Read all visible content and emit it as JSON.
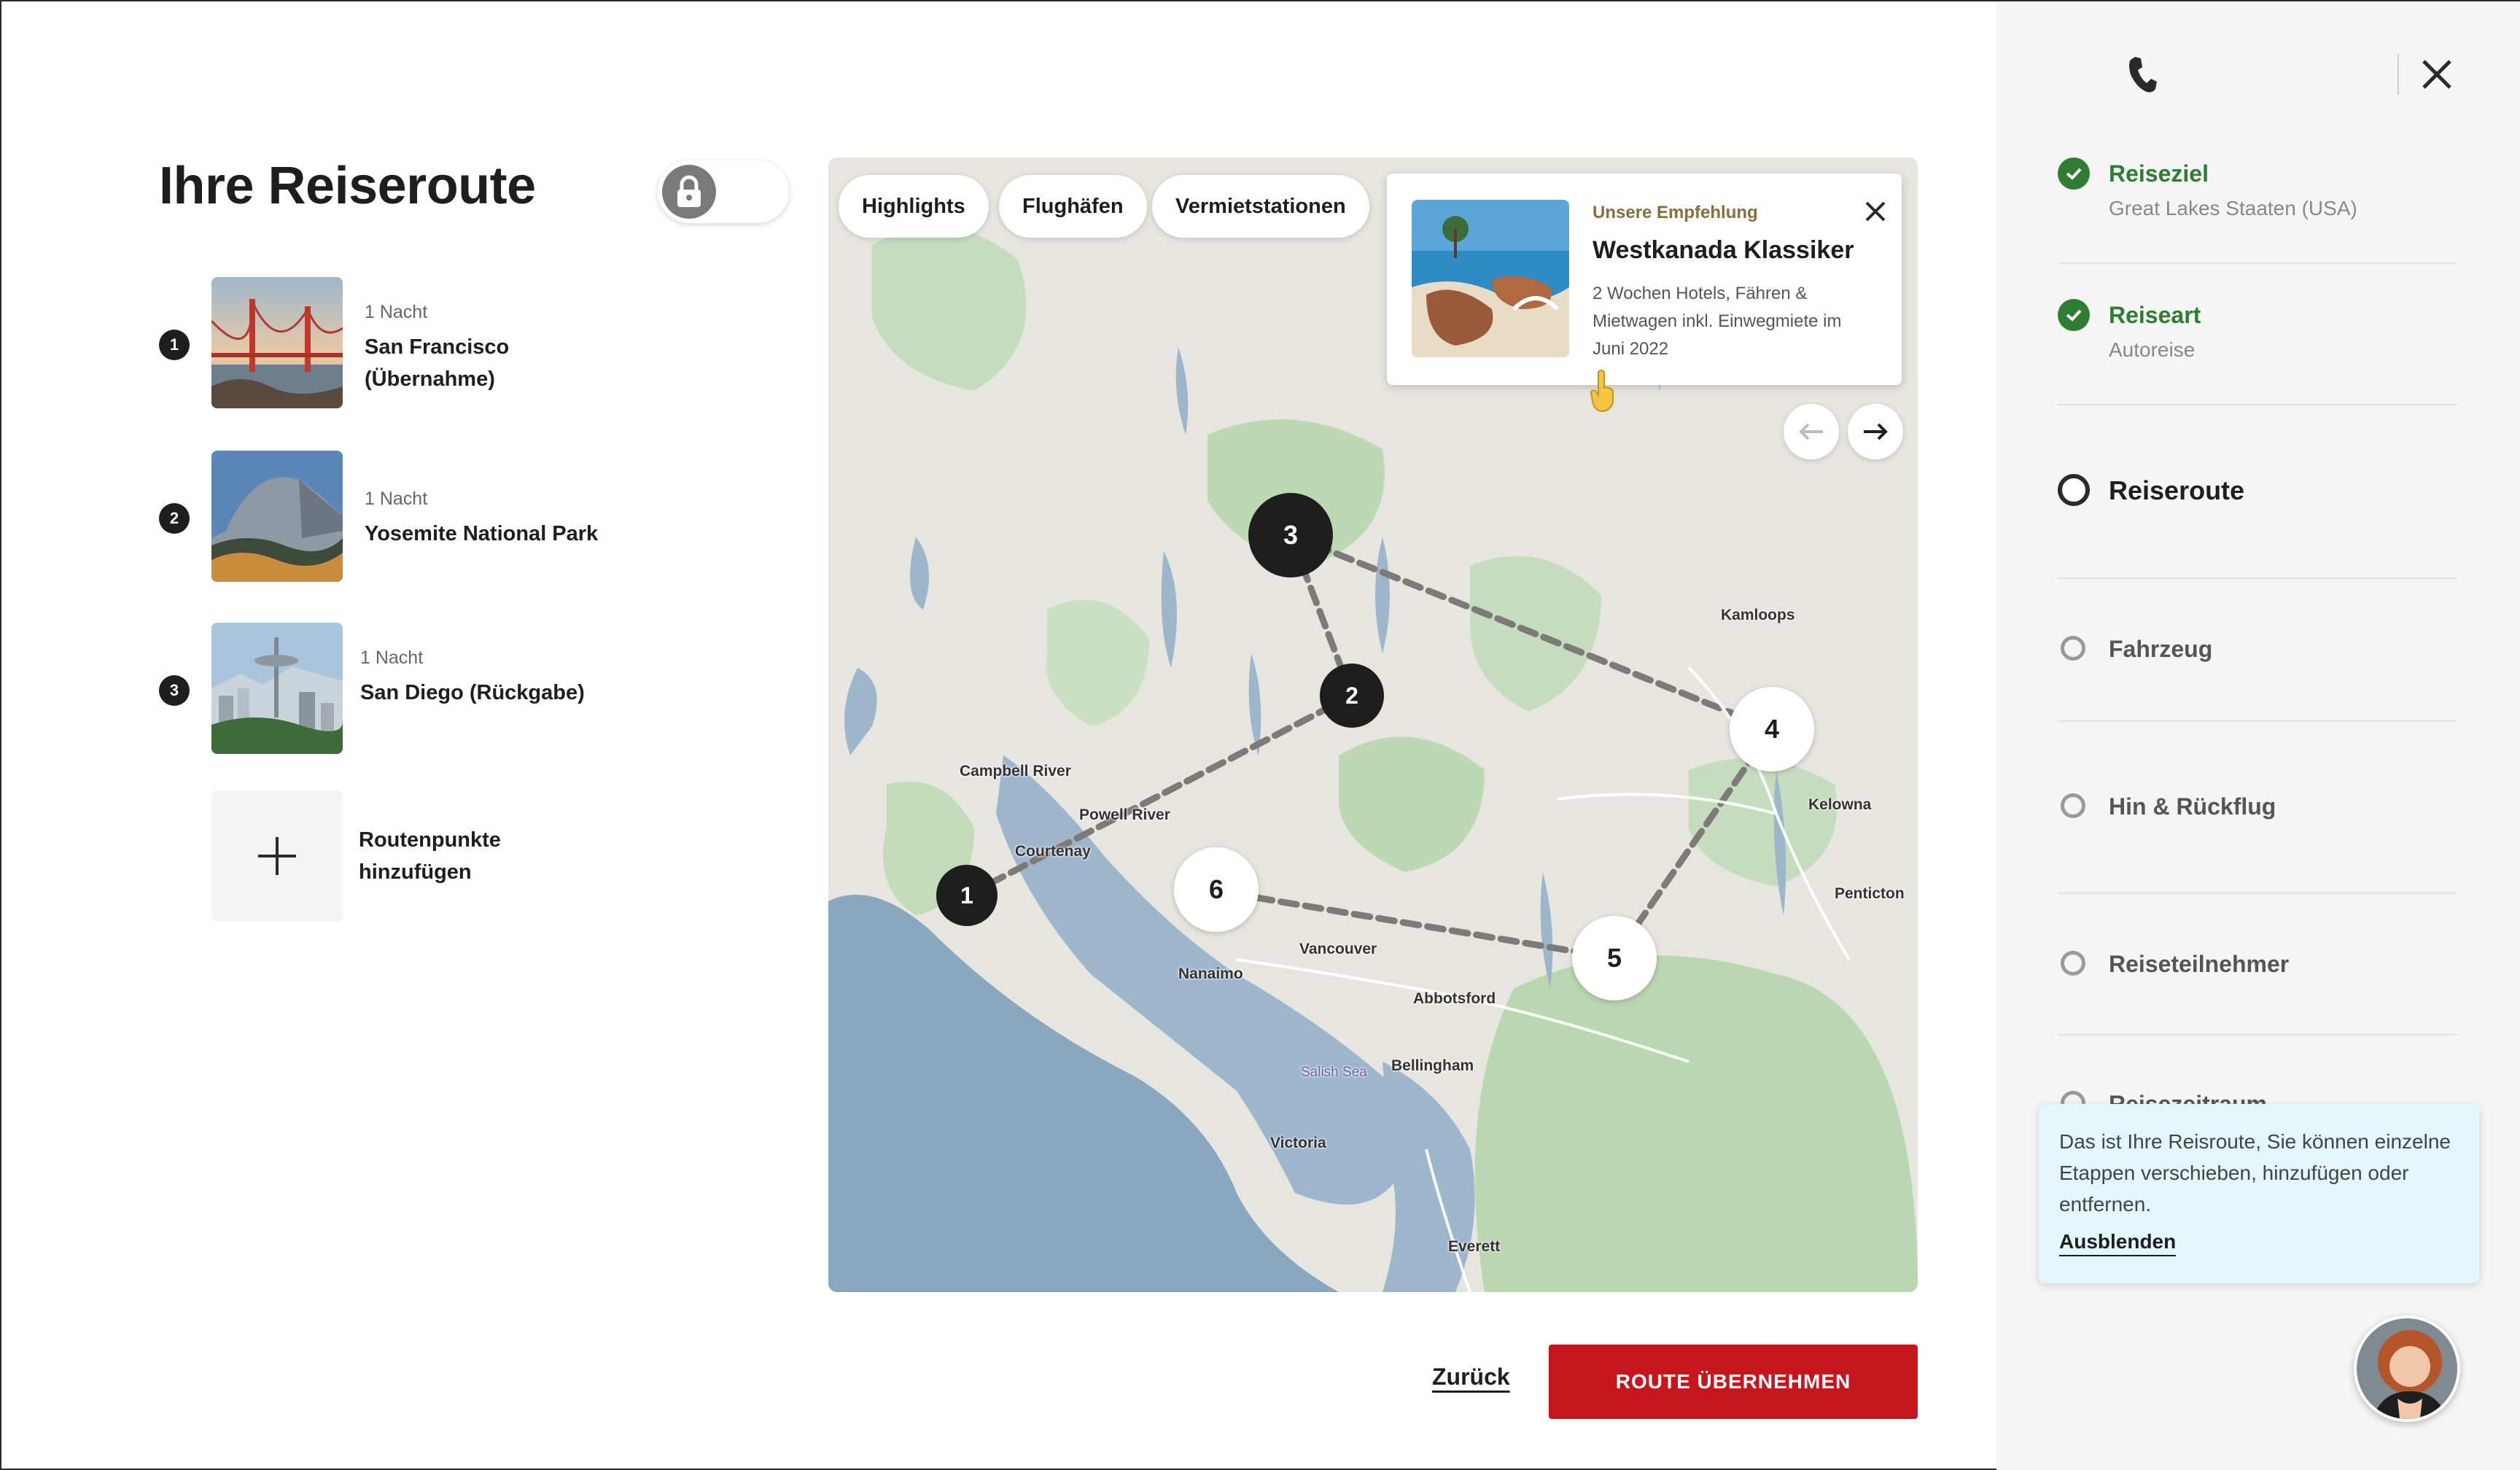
{
  "page": {
    "title": "Ihre Reiseroute"
  },
  "route": {
    "stops": [
      {
        "number": "1",
        "nights": "1 Nacht",
        "name": "San Francisco (Übernahme)"
      },
      {
        "number": "2",
        "nights": "1 Nacht",
        "name": "Yosemite National Park"
      },
      {
        "number": "3",
        "nights": "1 Nacht",
        "name": "San Diego (Rückgabe)"
      }
    ],
    "add_label": "Routenpunkte hinzufügen"
  },
  "map": {
    "filters": [
      "Highlights",
      "Flughäfen",
      "Vermietstationen"
    ],
    "recommendation": {
      "kicker": "Unsere Empfehlung",
      "title": "Westkanada Klassiker",
      "description": "2 Wochen Hotels, Fähren & Mietwagen inkl. Einwegmiete im Juni 2022"
    },
    "markers": [
      "1",
      "2",
      "3",
      "4",
      "5",
      "6"
    ],
    "places": [
      "Kamloops",
      "Campbell River",
      "Powell River",
      "Courtenay",
      "Kelowna",
      "Penticton",
      "Nanaimo",
      "Vancouver",
      "Abbotsford",
      "Salish Sea",
      "Bellingham",
      "Victoria",
      "Everett"
    ]
  },
  "actions": {
    "back": "Zurück",
    "confirm": "ROUTE ÜBERNEHMEN"
  },
  "steps": [
    {
      "label": "Reiseziel",
      "sub": "Great Lakes Staaten (USA)",
      "state": "done"
    },
    {
      "label": "Reiseart",
      "sub": "Autoreise",
      "state": "done"
    },
    {
      "label": "Reiseroute",
      "sub": "",
      "state": "current"
    },
    {
      "label": "Fahrzeug",
      "sub": "",
      "state": "todo"
    },
    {
      "label": "Hin & Rückflug",
      "sub": "",
      "state": "todo"
    },
    {
      "label": "Reiseteilnehmer",
      "sub": "",
      "state": "todo"
    },
    {
      "label": "Reisezeitraum",
      "sub": "",
      "state": "todo"
    }
  ],
  "help": {
    "text": "Das ist Ihre Reisroute, Sie können einzelne Etappen verschieben, hinzufügen oder entfernen.",
    "hide": "Ausblenden"
  },
  "colors": {
    "accent": "#c4161c",
    "done": "#2e7d32",
    "water": "#8aa7c0",
    "forest": "#bcd9b4"
  },
  "icons": {
    "lock": "lock-icon",
    "phone": "phone-icon",
    "close": "close-icon",
    "plus": "plus-icon"
  }
}
